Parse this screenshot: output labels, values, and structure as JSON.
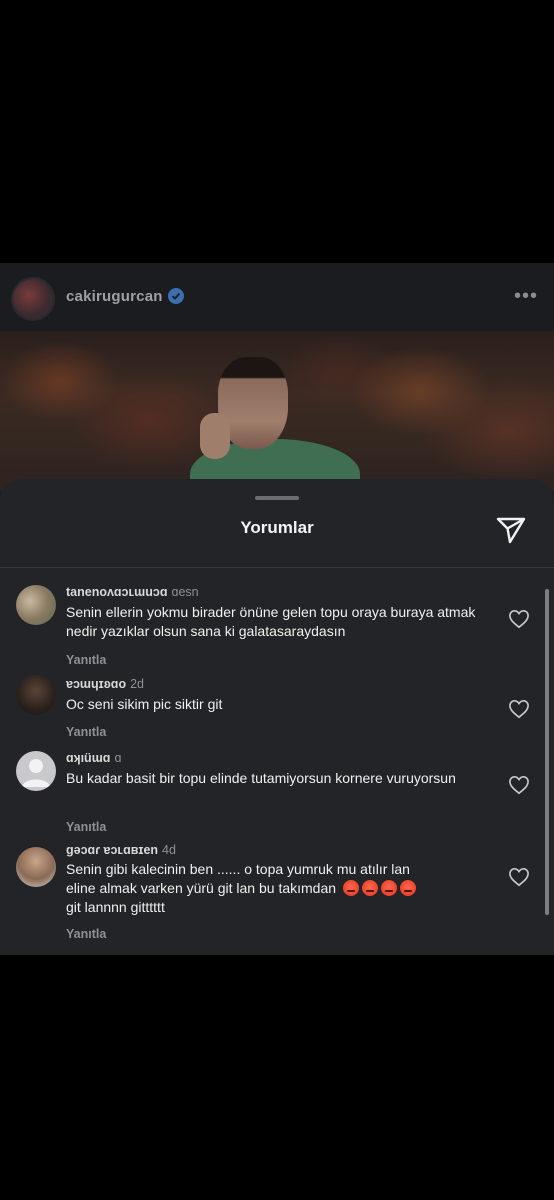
{
  "post": {
    "username": "cakirugurcan",
    "more_label": "•••"
  },
  "sheet": {
    "title": "Yorumlar"
  },
  "comments": [
    {
      "user": "tanenoʌɑɔʟɯuɔɑ",
      "time": "ɑesn",
      "text": "Senin ellerin yokmu birader önüne gelen topu oraya buraya atmak nedir yazıklar olsun sana ki galatasaraydasın",
      "reply": "Yanıtla"
    },
    {
      "user": "ɐɔɯɥɪʚɑo",
      "time": "2d",
      "text": "Oc seni sikim pic siktir git",
      "reply": "Yanıtla"
    },
    {
      "user": "ɑʞıüɯɑ",
      "time": "ɑ",
      "text": "Bu kadar basit bir topu elinde tutamiyorsun kornere vuruyorsun",
      "reply": "Yanıtla"
    },
    {
      "user": "gəɔɑɾ ɐɔʟɑʙɪen",
      "time": "4d",
      "text_line1": "Senin gibi kalecinin ben ...... o topa yumruk mu atılır lan",
      "text_line2": "eline almak varken yürü git lan bu takımdan",
      "text_line3": "git lannnn gitttttt",
      "reply": "Yanıtla"
    }
  ],
  "colors": {
    "sheet_bg": "#232427",
    "accent_verified": "#3a6fb0"
  }
}
